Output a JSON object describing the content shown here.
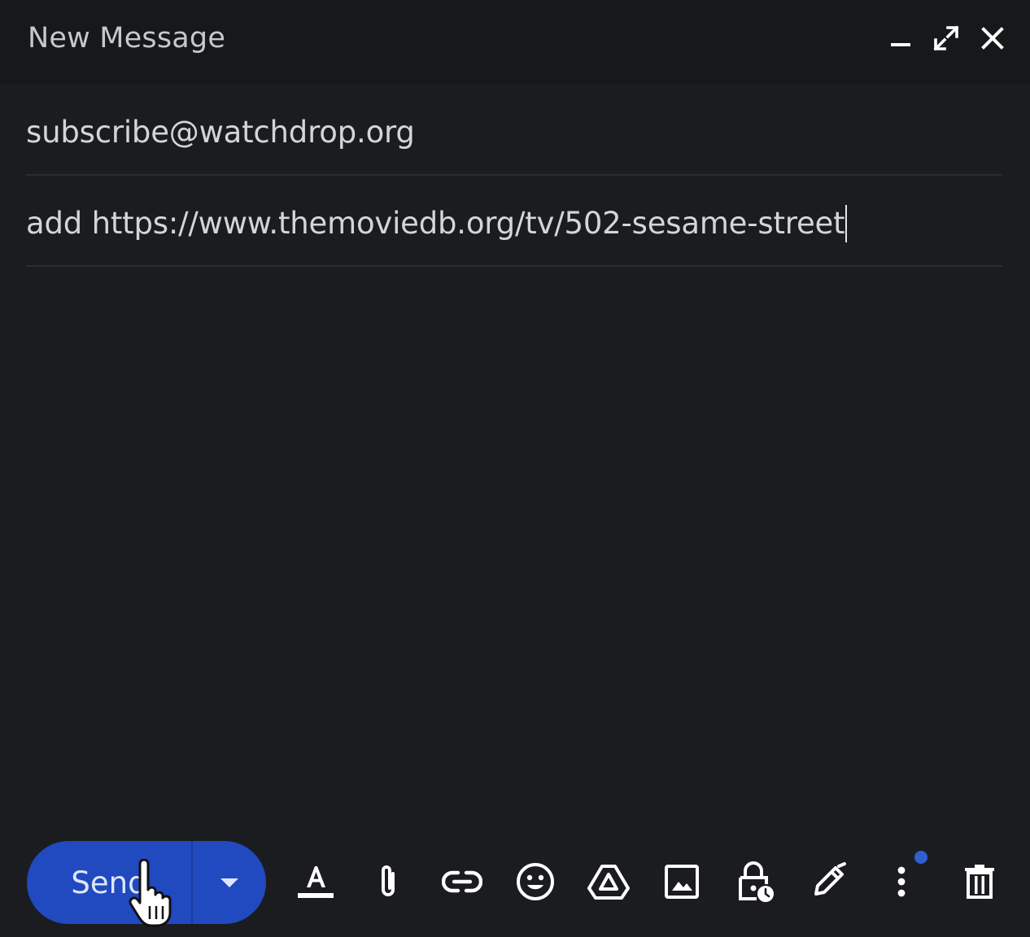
{
  "window": {
    "title": "New Message"
  },
  "header_icons": [
    "minimize-icon",
    "expand-icon",
    "close-icon"
  ],
  "compose": {
    "recipient": "subscribe@watchdrop.org",
    "subject": "add https://www.themoviedb.org/tv/502-sesame-street",
    "body": ""
  },
  "toolbar": {
    "send_label": "Send",
    "tools": [
      "formatting-options-icon",
      "attach-file-icon",
      "insert-link-icon",
      "insert-emoji-icon",
      "insert-from-drive-icon",
      "insert-photo-icon",
      "confidential-mode-icon",
      "insert-signature-icon",
      "more-options-icon",
      "discard-draft-icon"
    ]
  },
  "colors": {
    "background": "#1b1c1f",
    "header": "#16181a",
    "send_button": "#2149c0",
    "text": "#d4d5d7",
    "icon": "#e3e3e3",
    "notification_dot": "#2f5fd0"
  }
}
